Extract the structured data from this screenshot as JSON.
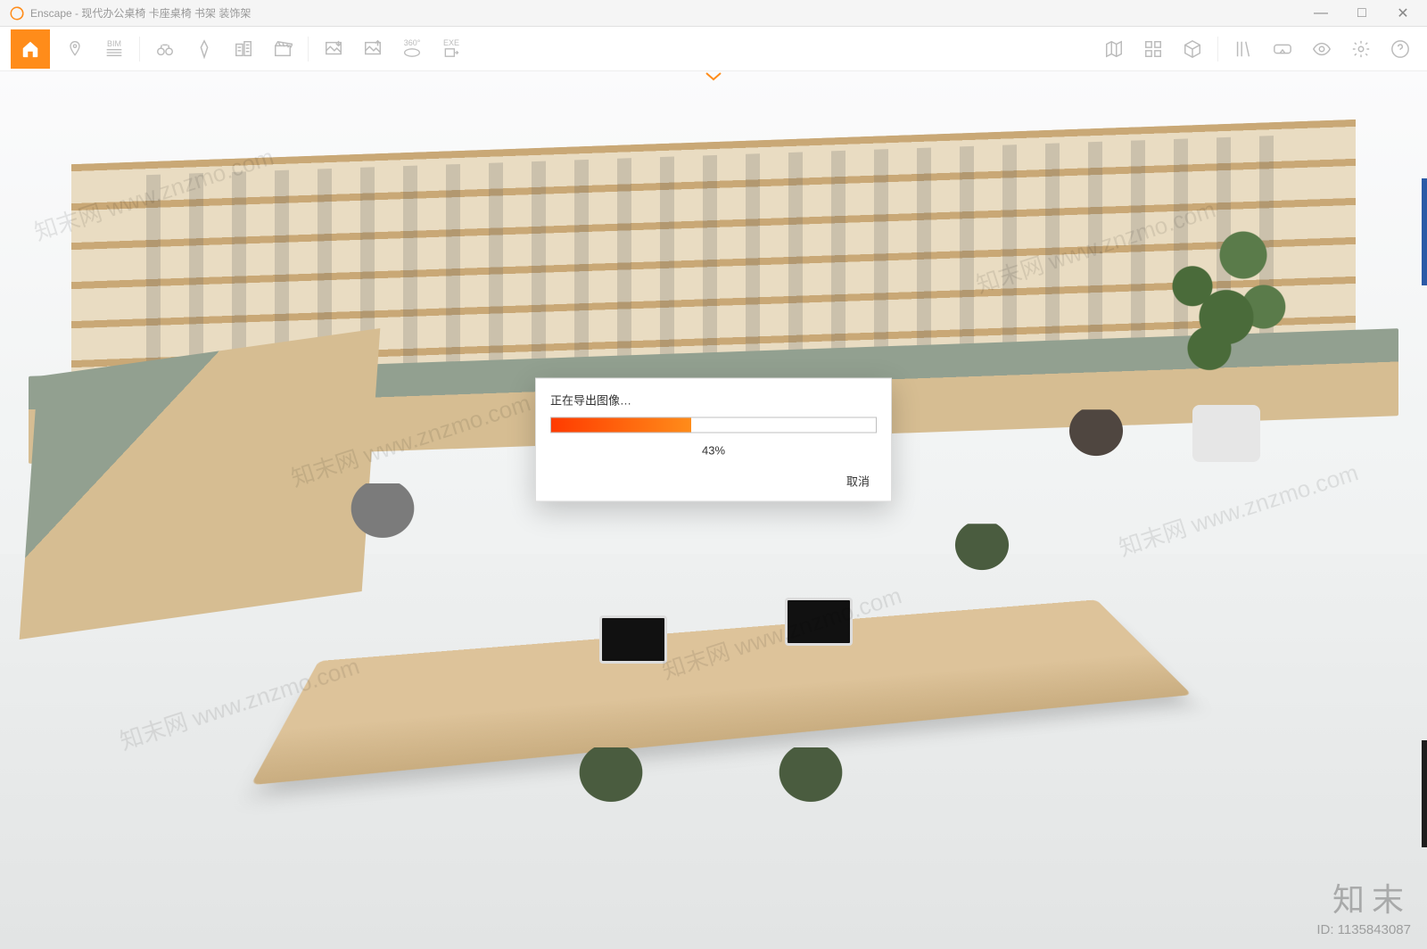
{
  "app": {
    "name": "Enscape",
    "document_title": "现代办公桌椅 卡座桌椅 书架 装饰架"
  },
  "window_controls": {
    "minimize": "—",
    "maximize": "□",
    "close": "✕"
  },
  "toolbar": {
    "left": [
      {
        "name": "home-icon",
        "label": "Home"
      },
      {
        "name": "pin-icon",
        "label": "Pin"
      },
      {
        "name": "bim-icon",
        "label": "BIM",
        "text": "BIM"
      },
      {
        "name": "binoculars-icon",
        "label": "Views"
      },
      {
        "name": "compass-icon",
        "label": "Orientation"
      },
      {
        "name": "building-icon",
        "label": "Project"
      },
      {
        "name": "clapper-icon",
        "label": "Video"
      },
      {
        "name": "import-image-icon",
        "label": "Import Image"
      },
      {
        "name": "export-image-icon",
        "label": "Export Image"
      },
      {
        "name": "panorama-icon",
        "label": "360°",
        "text": "360°"
      },
      {
        "name": "export-exe-icon",
        "label": "EXE Export",
        "text": "EXE"
      }
    ],
    "right": [
      {
        "name": "map-icon",
        "label": "Map"
      },
      {
        "name": "assets-icon",
        "label": "Assets"
      },
      {
        "name": "cube-icon",
        "label": "3D"
      },
      {
        "name": "library-icon",
        "label": "Library"
      },
      {
        "name": "vr-icon",
        "label": "VR"
      },
      {
        "name": "visibility-icon",
        "label": "Visibility"
      },
      {
        "name": "settings-icon",
        "label": "Settings"
      },
      {
        "name": "help-icon",
        "label": "Help"
      }
    ]
  },
  "dialog": {
    "title": "正在导出图像…",
    "percent": 43,
    "percent_text": "43%",
    "cancel_label": "取消"
  },
  "watermark": {
    "diag_text": "知末网 www.znzmo.com",
    "brand": "知末",
    "id_label": "ID: 1135843087"
  },
  "colors": {
    "accent": "#ff8c1a",
    "progress_start": "#ff3b00",
    "progress_end": "#ff8c1a"
  }
}
